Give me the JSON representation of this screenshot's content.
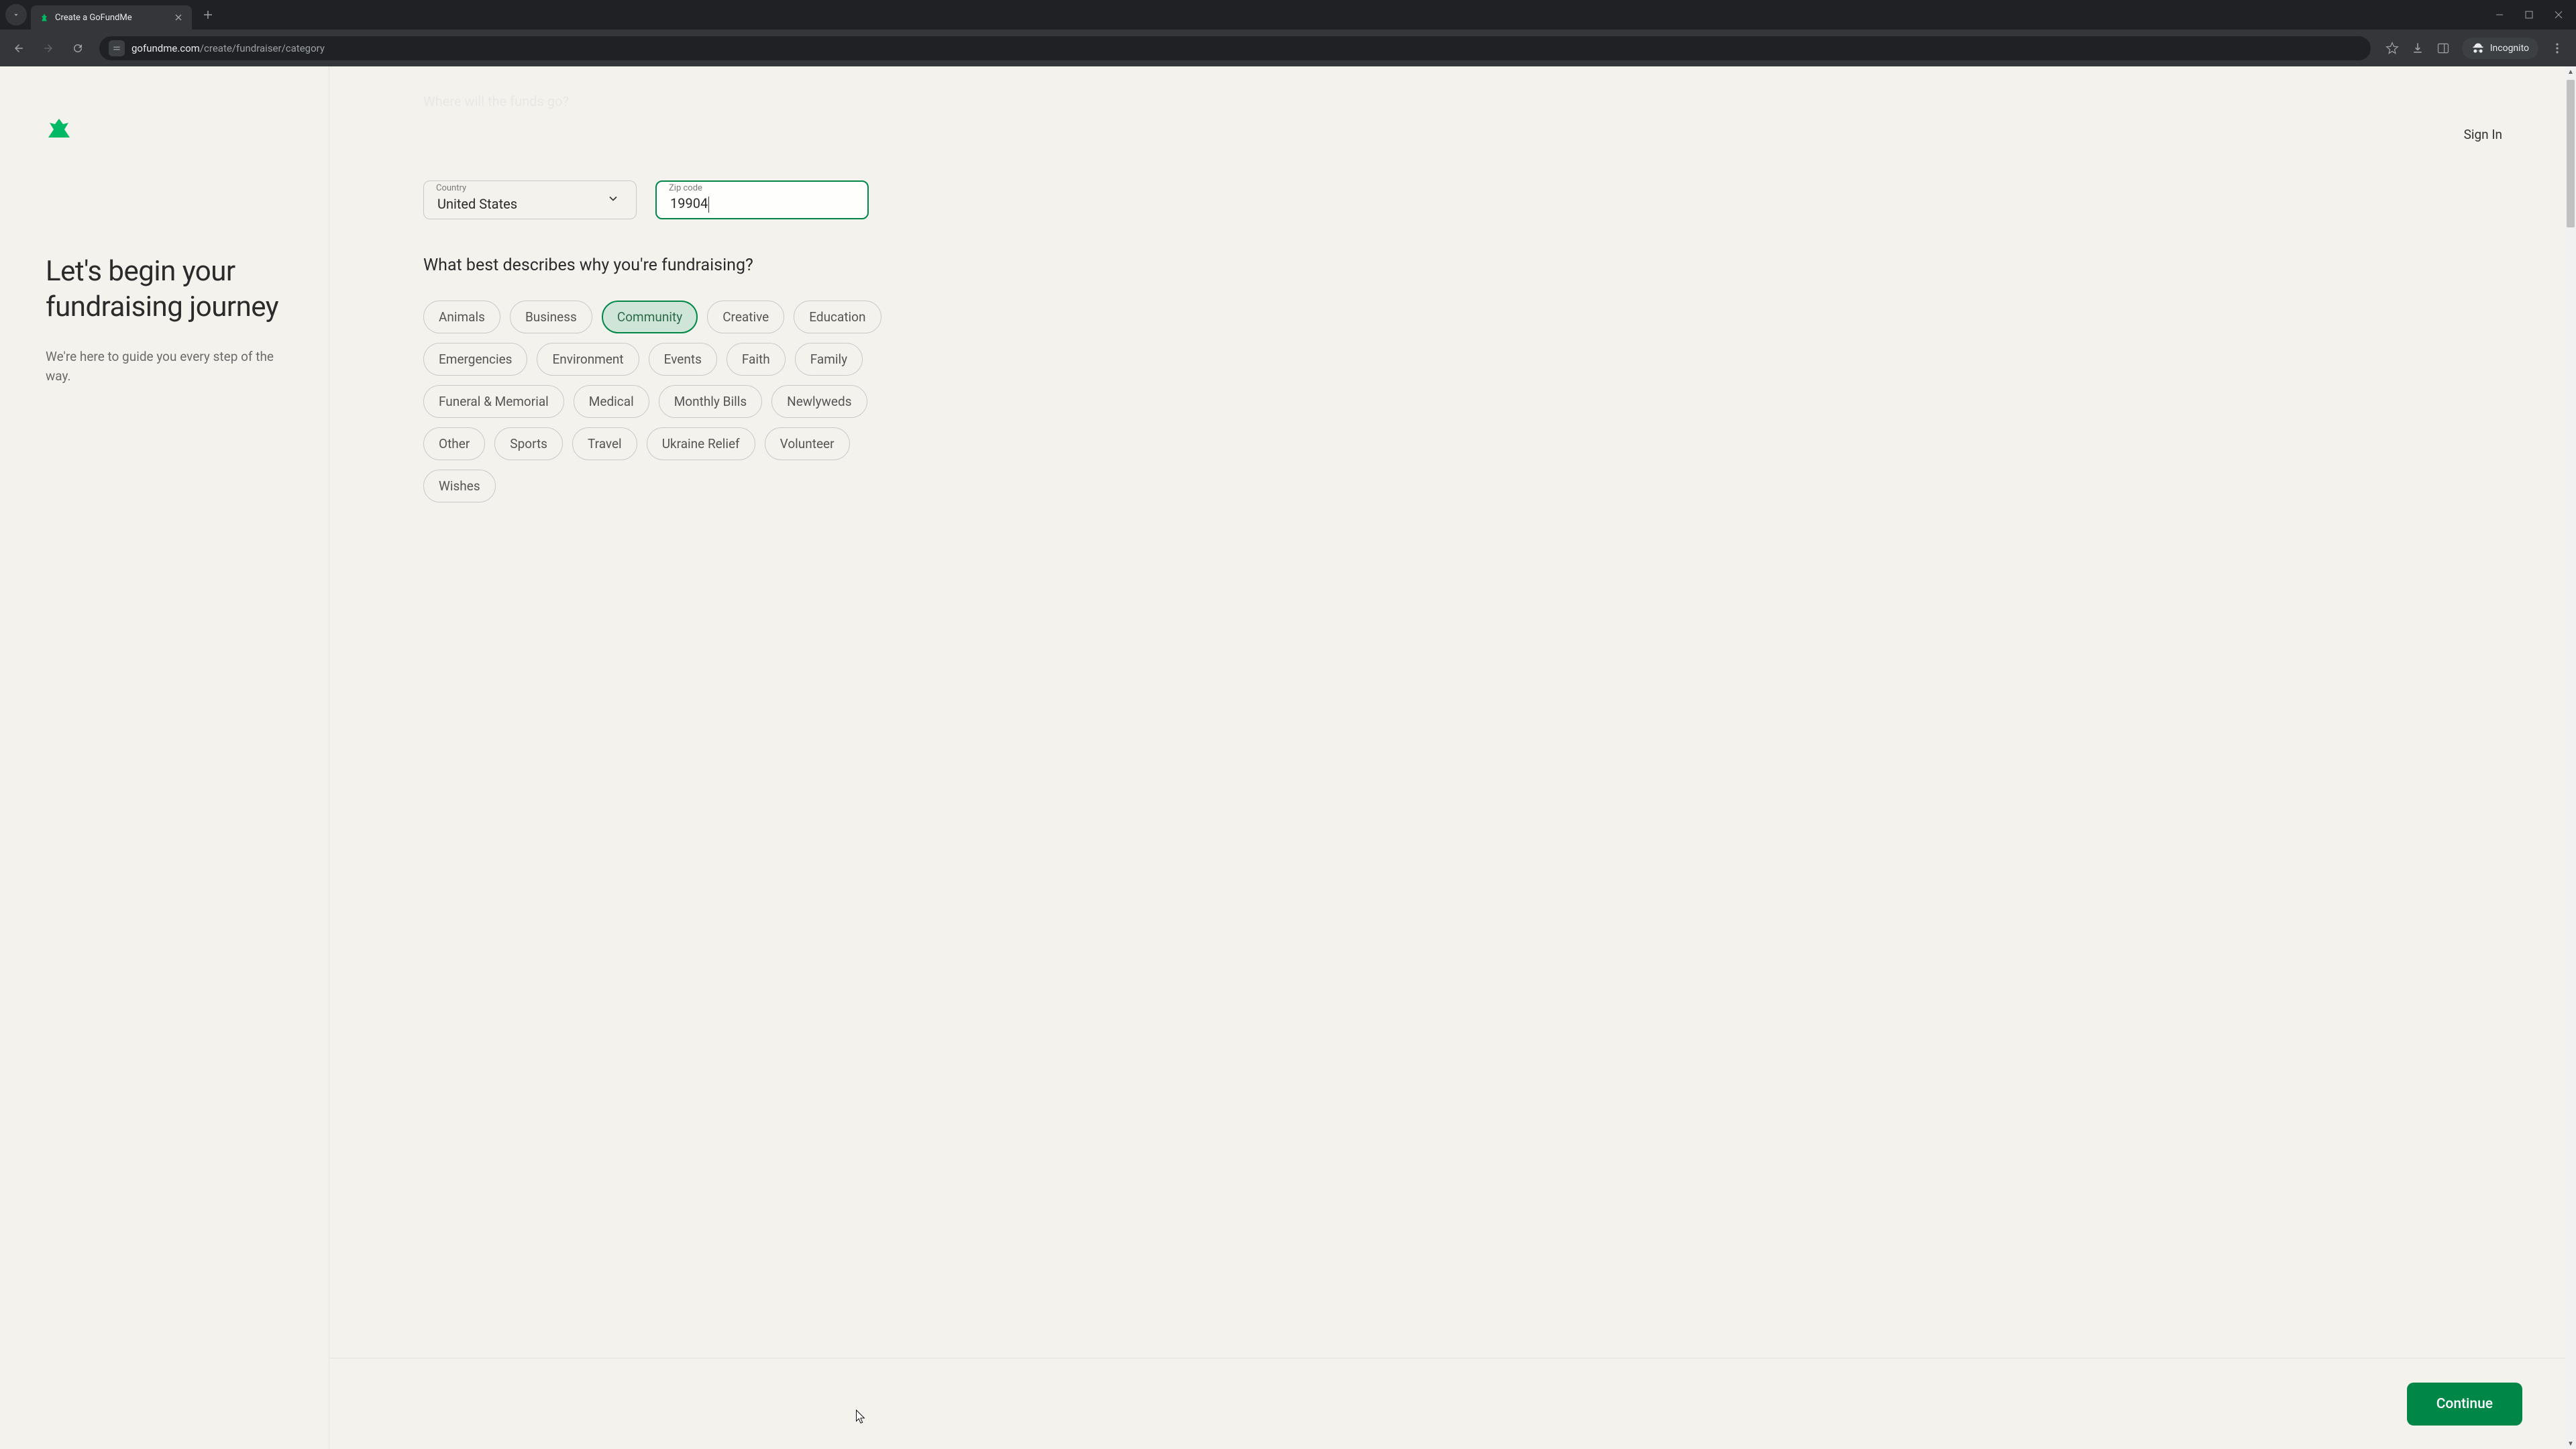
{
  "browser": {
    "tab_title": "Create a GoFundMe",
    "url_host": "gofundme.com",
    "url_path": "/create/fundraiser/category",
    "incognito_label": "Incognito"
  },
  "header": {
    "sign_in": "Sign In"
  },
  "left": {
    "headline": "Let's begin your fundraising journey",
    "subhead": "We're here to guide you every step of the way."
  },
  "form": {
    "hidden_question": "Where will the funds go?",
    "country_label": "Country",
    "country_value": "United States",
    "zip_label": "Zip code",
    "zip_value": "19904",
    "category_question": "What best describes why you're fundraising?",
    "categories": [
      "Animals",
      "Business",
      "Community",
      "Creative",
      "Education",
      "Emergencies",
      "Environment",
      "Events",
      "Faith",
      "Family",
      "Funeral & Memorial",
      "Medical",
      "Monthly Bills",
      "Newlyweds",
      "Other",
      "Sports",
      "Travel",
      "Ukraine Relief",
      "Volunteer",
      "Wishes"
    ],
    "selected_category": "Community",
    "continue_label": "Continue"
  },
  "colors": {
    "brand_green": "#008748",
    "page_bg": "#f4f2ec"
  }
}
